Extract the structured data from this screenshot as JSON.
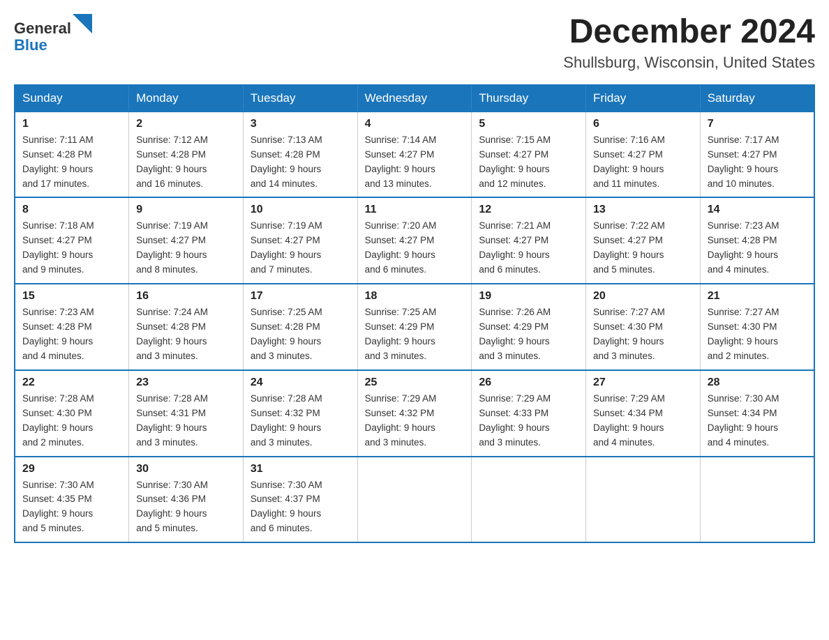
{
  "header": {
    "logo_text_general": "General",
    "logo_text_blue": "Blue",
    "month_title": "December 2024",
    "location": "Shullsburg, Wisconsin, United States"
  },
  "calendar": {
    "days_of_week": [
      "Sunday",
      "Monday",
      "Tuesday",
      "Wednesday",
      "Thursday",
      "Friday",
      "Saturday"
    ],
    "weeks": [
      [
        {
          "day": "1",
          "sunrise": "7:11 AM",
          "sunset": "4:28 PM",
          "daylight": "9 hours and 17 minutes."
        },
        {
          "day": "2",
          "sunrise": "7:12 AM",
          "sunset": "4:28 PM",
          "daylight": "9 hours and 16 minutes."
        },
        {
          "day": "3",
          "sunrise": "7:13 AM",
          "sunset": "4:28 PM",
          "daylight": "9 hours and 14 minutes."
        },
        {
          "day": "4",
          "sunrise": "7:14 AM",
          "sunset": "4:27 PM",
          "daylight": "9 hours and 13 minutes."
        },
        {
          "day": "5",
          "sunrise": "7:15 AM",
          "sunset": "4:27 PM",
          "daylight": "9 hours and 12 minutes."
        },
        {
          "day": "6",
          "sunrise": "7:16 AM",
          "sunset": "4:27 PM",
          "daylight": "9 hours and 11 minutes."
        },
        {
          "day": "7",
          "sunrise": "7:17 AM",
          "sunset": "4:27 PM",
          "daylight": "9 hours and 10 minutes."
        }
      ],
      [
        {
          "day": "8",
          "sunrise": "7:18 AM",
          "sunset": "4:27 PM",
          "daylight": "9 hours and 9 minutes."
        },
        {
          "day": "9",
          "sunrise": "7:19 AM",
          "sunset": "4:27 PM",
          "daylight": "9 hours and 8 minutes."
        },
        {
          "day": "10",
          "sunrise": "7:19 AM",
          "sunset": "4:27 PM",
          "daylight": "9 hours and 7 minutes."
        },
        {
          "day": "11",
          "sunrise": "7:20 AM",
          "sunset": "4:27 PM",
          "daylight": "9 hours and 6 minutes."
        },
        {
          "day": "12",
          "sunrise": "7:21 AM",
          "sunset": "4:27 PM",
          "daylight": "9 hours and 6 minutes."
        },
        {
          "day": "13",
          "sunrise": "7:22 AM",
          "sunset": "4:27 PM",
          "daylight": "9 hours and 5 minutes."
        },
        {
          "day": "14",
          "sunrise": "7:23 AM",
          "sunset": "4:28 PM",
          "daylight": "9 hours and 4 minutes."
        }
      ],
      [
        {
          "day": "15",
          "sunrise": "7:23 AM",
          "sunset": "4:28 PM",
          "daylight": "9 hours and 4 minutes."
        },
        {
          "day": "16",
          "sunrise": "7:24 AM",
          "sunset": "4:28 PM",
          "daylight": "9 hours and 3 minutes."
        },
        {
          "day": "17",
          "sunrise": "7:25 AM",
          "sunset": "4:28 PM",
          "daylight": "9 hours and 3 minutes."
        },
        {
          "day": "18",
          "sunrise": "7:25 AM",
          "sunset": "4:29 PM",
          "daylight": "9 hours and 3 minutes."
        },
        {
          "day": "19",
          "sunrise": "7:26 AM",
          "sunset": "4:29 PM",
          "daylight": "9 hours and 3 minutes."
        },
        {
          "day": "20",
          "sunrise": "7:27 AM",
          "sunset": "4:30 PM",
          "daylight": "9 hours and 3 minutes."
        },
        {
          "day": "21",
          "sunrise": "7:27 AM",
          "sunset": "4:30 PM",
          "daylight": "9 hours and 2 minutes."
        }
      ],
      [
        {
          "day": "22",
          "sunrise": "7:28 AM",
          "sunset": "4:30 PM",
          "daylight": "9 hours and 2 minutes."
        },
        {
          "day": "23",
          "sunrise": "7:28 AM",
          "sunset": "4:31 PM",
          "daylight": "9 hours and 3 minutes."
        },
        {
          "day": "24",
          "sunrise": "7:28 AM",
          "sunset": "4:32 PM",
          "daylight": "9 hours and 3 minutes."
        },
        {
          "day": "25",
          "sunrise": "7:29 AM",
          "sunset": "4:32 PM",
          "daylight": "9 hours and 3 minutes."
        },
        {
          "day": "26",
          "sunrise": "7:29 AM",
          "sunset": "4:33 PM",
          "daylight": "9 hours and 3 minutes."
        },
        {
          "day": "27",
          "sunrise": "7:29 AM",
          "sunset": "4:34 PM",
          "daylight": "9 hours and 4 minutes."
        },
        {
          "day": "28",
          "sunrise": "7:30 AM",
          "sunset": "4:34 PM",
          "daylight": "9 hours and 4 minutes."
        }
      ],
      [
        {
          "day": "29",
          "sunrise": "7:30 AM",
          "sunset": "4:35 PM",
          "daylight": "9 hours and 5 minutes."
        },
        {
          "day": "30",
          "sunrise": "7:30 AM",
          "sunset": "4:36 PM",
          "daylight": "9 hours and 5 minutes."
        },
        {
          "day": "31",
          "sunrise": "7:30 AM",
          "sunset": "4:37 PM",
          "daylight": "9 hours and 6 minutes."
        },
        null,
        null,
        null,
        null
      ]
    ],
    "labels": {
      "sunrise": "Sunrise:",
      "sunset": "Sunset:",
      "daylight": "Daylight:"
    }
  }
}
